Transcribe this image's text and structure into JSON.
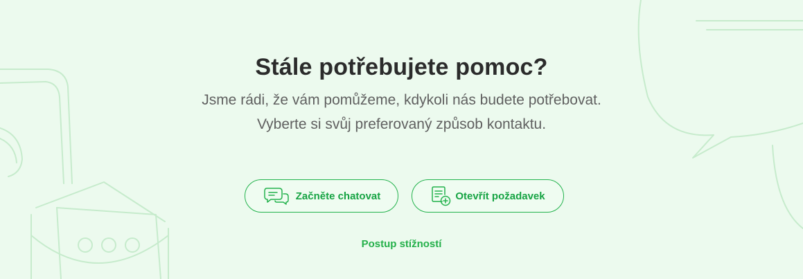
{
  "heading": "Stále potřebujete pomoc?",
  "subtitle": {
    "line1": "Jsme rádi, že vám pomůžeme, kdykoli nás budete potřebovat.",
    "line2": "Vyberte si svůj preferovaný způsob kontaktu."
  },
  "buttons": {
    "chat": {
      "label": "Začněte chatovat",
      "icon": "chat-bubbles-icon"
    },
    "request": {
      "label": "Otevřít požadavek",
      "icon": "document-add-icon"
    }
  },
  "complaint_link": "Postup stížností",
  "colors": {
    "background": "#ecfaee",
    "accent": "#22b24c",
    "heading": "#2b2b2b",
    "text": "#606060",
    "decor": "#c6ebcc"
  }
}
